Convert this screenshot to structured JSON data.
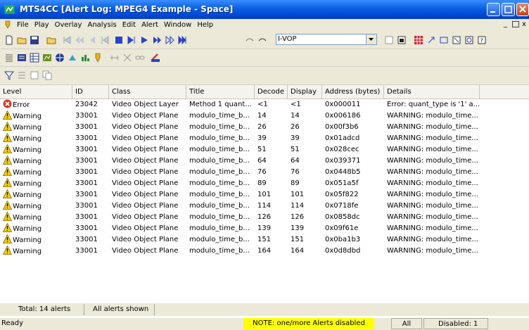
{
  "window": {
    "title": "MTS4CC [Alert Log: MPEG4 Example - Space]"
  },
  "menu": {
    "items": [
      "File",
      "Play",
      "Overlay",
      "Analysis",
      "Edit",
      "Alert",
      "Window",
      "Help"
    ]
  },
  "toolbar": {
    "vop_select": "I-VOP"
  },
  "table": {
    "columns": [
      "Level",
      "ID",
      "Class",
      "Title",
      "Decode",
      "Display",
      "Address (bytes)",
      "Details"
    ],
    "rows": [
      {
        "level": "Error",
        "id": "23042",
        "class": "Video Object Layer",
        "title": "Method 1 quant...",
        "decode": "<1",
        "display": "<1",
        "address": "0x000011",
        "details": "Error: quant_type is '1' a..."
      },
      {
        "level": "Warning",
        "id": "33001",
        "class": "Video Object Plane",
        "title": "modulo_time_b...",
        "decode": "14",
        "display": "14",
        "address": "0x006186",
        "details": "WARNING: modulo_time..."
      },
      {
        "level": "Warning",
        "id": "33001",
        "class": "Video Object Plane",
        "title": "modulo_time_b...",
        "decode": "26",
        "display": "26",
        "address": "0x00f3b6",
        "details": "WARNING: modulo_time..."
      },
      {
        "level": "Warning",
        "id": "33001",
        "class": "Video Object Plane",
        "title": "modulo_time_b...",
        "decode": "39",
        "display": "39",
        "address": "0x01adcd",
        "details": "WARNING: modulo_time..."
      },
      {
        "level": "Warning",
        "id": "33001",
        "class": "Video Object Plane",
        "title": "modulo_time_b...",
        "decode": "51",
        "display": "51",
        "address": "0x028cec",
        "details": "WARNING: modulo_time..."
      },
      {
        "level": "Warning",
        "id": "33001",
        "class": "Video Object Plane",
        "title": "modulo_time_b...",
        "decode": "64",
        "display": "64",
        "address": "0x039371",
        "details": "WARNING: modulo_time..."
      },
      {
        "level": "Warning",
        "id": "33001",
        "class": "Video Object Plane",
        "title": "modulo_time_b...",
        "decode": "76",
        "display": "76",
        "address": "0x0448b5",
        "details": "WARNING: modulo_time..."
      },
      {
        "level": "Warning",
        "id": "33001",
        "class": "Video Object Plane",
        "title": "modulo_time_b...",
        "decode": "89",
        "display": "89",
        "address": "0x051a5f",
        "details": "WARNING: modulo_time..."
      },
      {
        "level": "Warning",
        "id": "33001",
        "class": "Video Object Plane",
        "title": "modulo_time_b...",
        "decode": "101",
        "display": "101",
        "address": "0x05f822",
        "details": "WARNING: modulo_time..."
      },
      {
        "level": "Warning",
        "id": "33001",
        "class": "Video Object Plane",
        "title": "modulo_time_b...",
        "decode": "114",
        "display": "114",
        "address": "0x0718fe",
        "details": "WARNING: modulo_time..."
      },
      {
        "level": "Warning",
        "id": "33001",
        "class": "Video Object Plane",
        "title": "modulo_time_b...",
        "decode": "126",
        "display": "126",
        "address": "0x0858dc",
        "details": "WARNING: modulo_time..."
      },
      {
        "level": "Warning",
        "id": "33001",
        "class": "Video Object Plane",
        "title": "modulo_time_b...",
        "decode": "139",
        "display": "139",
        "address": "0x09f61e",
        "details": "WARNING: modulo_time..."
      },
      {
        "level": "Warning",
        "id": "33001",
        "class": "Video Object Plane",
        "title": "modulo_time_b...",
        "decode": "151",
        "display": "151",
        "address": "0x0ba1b3",
        "details": "WARNING: modulo_time..."
      },
      {
        "level": "Warning",
        "id": "33001",
        "class": "Video Object Plane",
        "title": "modulo_time_b...",
        "decode": "164",
        "display": "164",
        "address": "0x0d8dbd",
        "details": "WARNING: modulo_time..."
      }
    ]
  },
  "footer": {
    "total": "Total: 14 alerts",
    "shown": "All alerts shown"
  },
  "status": {
    "ready": "Ready",
    "note": "NOTE: one/more Alerts disabled",
    "filter": "All",
    "disabled": "Disabled: 1"
  },
  "colors": {
    "title_bar": "#0A5FE0",
    "note_highlight": "#FFFF00",
    "error_icon": "#D83A24",
    "warning_icon": "#F5D000"
  }
}
